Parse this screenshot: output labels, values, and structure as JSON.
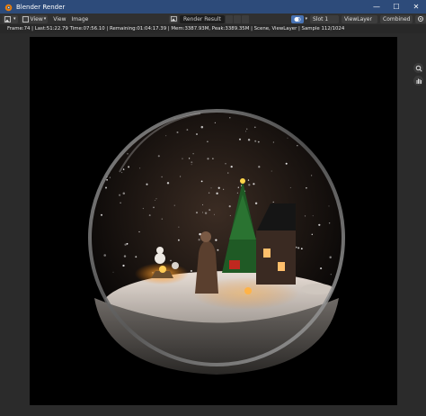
{
  "window": {
    "title": "Blender Render",
    "controls": {
      "minimize": "—",
      "maximize": "☐",
      "close": "✕"
    }
  },
  "header": {
    "menus": [
      "View",
      "View",
      "Image"
    ],
    "image_name": "Render Result",
    "slot": "Slot 1",
    "view_layer": "ViewLayer",
    "pass": "Combined"
  },
  "status_line": "Frame:74 | Last:51:22.79 Time:07:56.10 | Remaining:01:04:17.39 | Mem:3387.93M, Peak:3389.35M | Scene, ViewLayer | Sample 112/1024",
  "accent_color": "#4772b3"
}
